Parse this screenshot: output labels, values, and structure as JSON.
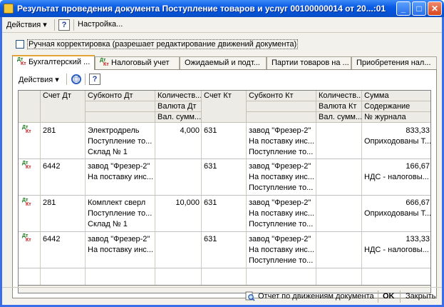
{
  "window": {
    "title": "Результат проведения документа Поступление товаров и услуг 00100000014 от 20...:01",
    "controls": {
      "minimize": "_",
      "maximize": "□",
      "close": "✕"
    }
  },
  "menubar": {
    "actions_label": "Действия ▾",
    "help_label": "?",
    "settings_label": "Настройка..."
  },
  "manual_correction": {
    "label": "Ручная корректировка (разрешает редактирование движений документа)",
    "checked": false
  },
  "tabs": [
    {
      "label": "Бухгалтерский ...",
      "icon": "dt-kt-icon",
      "active": true
    },
    {
      "label": "Налоговый учет",
      "icon": "dt-kt-tax-icon",
      "active": false
    },
    {
      "label": "Ожидаемый и подт...",
      "active": false
    },
    {
      "label": "Партии товаров на ...",
      "active": false
    },
    {
      "label": "Приобретения нал...",
      "active": false
    }
  ],
  "subtoolbar": {
    "actions_label": "Действия ▾",
    "refresh_icon": "refresh-icon",
    "help_label": "?"
  },
  "grid": {
    "headers": {
      "schet_dt": "Счет Дт",
      "subkonto_dt": "Субконто Дт",
      "kolichestvo_dt": "Количеств...",
      "valuta_dt": "Валюта Дт",
      "val_summa_dt": "Вал. сумм...",
      "schet_kt": "Счет Кт",
      "subkonto_kt": "Субконто Кт",
      "kolichestvo_kt": "Количеств...",
      "valuta_kt": "Валюта Кт",
      "val_summa_kt": "Вал. сумм...",
      "summa": "Сумма",
      "soderzhanie": "Содержание",
      "nomer_zhurnala": "№ журнала"
    },
    "rows": [
      {
        "schet_dt": "281",
        "subkonto_dt": [
          "Электродрель",
          "Поступление то...",
          "Склад № 1"
        ],
        "kolichestvo_dt": "4,000",
        "schet_kt": "631",
        "subkonto_kt": [
          "завод \"Фрезер-2\"",
          "На поставку инс...",
          "Поступление то..."
        ],
        "summa": "833,33",
        "soderzhanie": "Оприходованы Т..."
      },
      {
        "schet_dt": "6442",
        "subkonto_dt": [
          "завод \"Фрезер-2\"",
          "На поставку инс...",
          ""
        ],
        "kolichestvo_dt": "",
        "schet_kt": "631",
        "subkonto_kt": [
          "завод \"Фрезер-2\"",
          "На поставку инс...",
          "Поступление то..."
        ],
        "summa": "166,67",
        "soderzhanie": "НДС - налоговы..."
      },
      {
        "schet_dt": "281",
        "subkonto_dt": [
          "Комплект сверл",
          "Поступление то...",
          "Склад № 1"
        ],
        "kolichestvo_dt": "10,000",
        "schet_kt": "631",
        "subkonto_kt": [
          "завод \"Фрезер-2\"",
          "На поставку инс...",
          "Поступление то..."
        ],
        "summa": "666,67",
        "soderzhanie": "Оприходованы Т..."
      },
      {
        "schet_dt": "6442",
        "subkonto_dt": [
          "завод \"Фрезер-2\"",
          "На поставку инс...",
          ""
        ],
        "kolichestvo_dt": "",
        "schet_kt": "631",
        "subkonto_kt": [
          "завод \"Фрезер-2\"",
          "На поставку инс...",
          "Поступление то..."
        ],
        "summa": "133,33",
        "soderzhanie": "НДС - налоговы..."
      }
    ],
    "row_icon": {
      "dt": "Дт",
      "kt": "Кт"
    }
  },
  "footer": {
    "report_label": "Отчет по движениям документа",
    "ok_label": "OK",
    "close_label": "Закрыть"
  },
  "colors": {
    "titlebar": "#0a5ce6",
    "window_bg": "#f2f1ec",
    "active_tab_accent": "#e6a437",
    "dt_color": "#1a7a1a",
    "kt_color": "#c01818"
  }
}
